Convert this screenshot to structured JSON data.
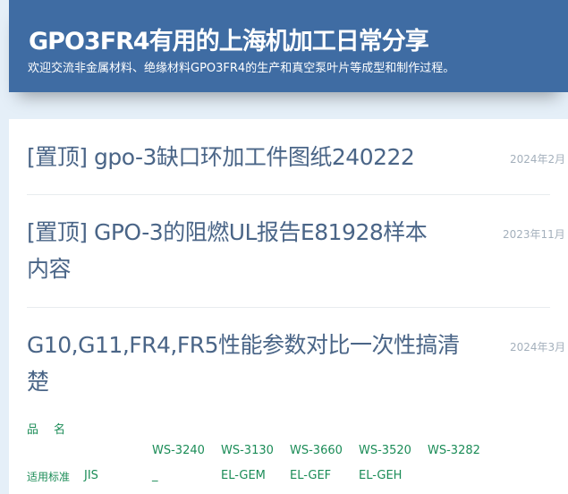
{
  "site": {
    "title": "GPO3FR4有用的上海机加工日常分享",
    "description": "欢迎交流非金属材料、绝缘材料GPO3FR4的生产和真空泵叶片等成型和制作过程。"
  },
  "posts": [
    {
      "title": "[置顶] gpo-3缺口环加工件图纸240222",
      "date": "2024年2月"
    },
    {
      "title_line1": "[置顶] GPO-3的阻燃UL报告E81928样本",
      "title_line2": "内容",
      "date": "2023年11月"
    },
    {
      "title_line1": "G10,G11,FR4,FR5性能参数对比一次性搞清",
      "title_line2": "楚",
      "date": "2024年3月"
    }
  ],
  "spec_table": {
    "product_name_label": "品　名",
    "standard_label": "适用标准",
    "standard_value": "JIS",
    "columns": [
      {
        "line1": "WS-3240",
        "line2": "_"
      },
      {
        "line1": "WS-3130",
        "line2": "EL-GEM"
      },
      {
        "line1": "WS-3660",
        "line2": "EL-GEF"
      },
      {
        "line1": "WS-3520",
        "line2": "EL-GEH"
      },
      {
        "line1": "WS-3282",
        "line2": ""
      }
    ]
  }
}
